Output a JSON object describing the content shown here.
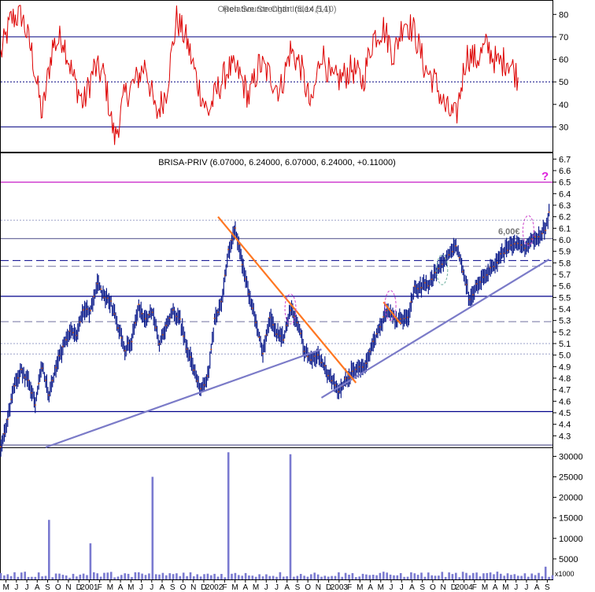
{
  "chart_data": [
    {
      "panel": "rsi",
      "type": "line",
      "title": "Relative Strength Index (14)",
      "title_overlay": "Open Source Chart (5,14,5,10)",
      "y_ticks": [
        "80",
        "70",
        "60",
        "50",
        "40",
        "30"
      ],
      "ylim": [
        20,
        85
      ],
      "reference_lines": [
        70,
        50,
        30
      ],
      "colors": {
        "line": "#dd0000",
        "ref": "#000080"
      },
      "series_key": [
        [
          0,
          62
        ],
        [
          3,
          78
        ],
        [
          6,
          80
        ],
        [
          9,
          63
        ],
        [
          12,
          35
        ],
        [
          15,
          66
        ],
        [
          18,
          70
        ],
        [
          21,
          52
        ],
        [
          24,
          40
        ],
        [
          27,
          56
        ],
        [
          30,
          53
        ],
        [
          33,
          24
        ],
        [
          36,
          44
        ],
        [
          39,
          50
        ],
        [
          42,
          58
        ],
        [
          45,
          35
        ],
        [
          48,
          46
        ],
        [
          51,
          78
        ],
        [
          54,
          68
        ],
        [
          57,
          50
        ],
        [
          60,
          36
        ],
        [
          63,
          47
        ],
        [
          66,
          56
        ],
        [
          69,
          54
        ],
        [
          72,
          43
        ],
        [
          75,
          58
        ],
        [
          78,
          53
        ],
        [
          81,
          46
        ],
        [
          84,
          64
        ],
        [
          87,
          57
        ],
        [
          90,
          38
        ],
        [
          93,
          64
        ],
        [
          96,
          50
        ],
        [
          99,
          52
        ],
        [
          102,
          56
        ],
        [
          105,
          50
        ],
        [
          108,
          70
        ],
        [
          111,
          74
        ],
        [
          114,
          62
        ],
        [
          117,
          78
        ],
        [
          120,
          72
        ],
        [
          123,
          56
        ],
        [
          126,
          50
        ],
        [
          129,
          38
        ],
        [
          132,
          34
        ],
        [
          135,
          62
        ],
        [
          138,
          60
        ],
        [
          141,
          66
        ],
        [
          144,
          58
        ],
        [
          147,
          60
        ],
        [
          150,
          52
        ]
      ]
    },
    {
      "panel": "price",
      "type": "line",
      "title": "BRISA-PRIV (6.07000, 6.24000, 6.07000, 6.24000, +0.11000)",
      "y_ticks": [
        "6.7",
        "6.6",
        "6.5",
        "6.4",
        "6.3",
        "6.2",
        "6.1",
        "6.0",
        "5.9",
        "5.8",
        "5.7",
        "5.6",
        "5.5",
        "5.4",
        "5.3",
        "5.2",
        "5.1",
        "5.0",
        "4.9",
        "4.8",
        "4.7",
        "4.6",
        "4.5",
        "4.4",
        "4.3"
      ],
      "ylim": [
        4.2,
        6.75
      ],
      "annotations": {
        "level_label": "6,00€",
        "question": "?"
      },
      "horizontal_levels": [
        {
          "y": 6.5,
          "color": "#cc33cc",
          "style": "solid"
        },
        {
          "y": 6.17,
          "color": "#9aa0c8",
          "style": "dotted"
        },
        {
          "y": 6.01,
          "color": "#7070a0",
          "style": "solid"
        },
        {
          "y": 5.82,
          "color": "#00008b",
          "style": "dashed"
        },
        {
          "y": 5.77,
          "color": "#7070a0",
          "style": "dashed"
        },
        {
          "y": 5.51,
          "color": "#00008b",
          "style": "solid"
        },
        {
          "y": 5.29,
          "color": "#7070a0",
          "style": "dashed"
        },
        {
          "y": 5.1,
          "color": "#9aa0c8",
          "style": "dotted"
        },
        {
          "y": 5.01,
          "color": "#9aa0c8",
          "style": "dotted"
        },
        {
          "y": 4.51,
          "color": "#00008b",
          "style": "solid"
        },
        {
          "y": 4.22,
          "color": "#7070a0",
          "style": "solid"
        }
      ],
      "trendlines": [
        {
          "color": "#7b7bc8",
          "from": [
            13,
            4.2
          ],
          "to": [
            93,
            5.05
          ]
        },
        {
          "color": "#7b7bc8",
          "from": [
            93,
            4.63
          ],
          "to": [
            159,
            5.83
          ]
        },
        {
          "color": "#ff7722",
          "from": [
            63,
            6.2
          ],
          "to": [
            103,
            4.76
          ]
        },
        {
          "color": "#ff7722",
          "from": [
            111,
            5.46
          ],
          "to": [
            116,
            5.27
          ]
        }
      ],
      "highlights": [
        [
          84,
          5.4
        ],
        [
          113,
          5.43
        ],
        [
          128,
          5.74
        ],
        [
          153,
          6.08
        ]
      ],
      "series_key": [
        [
          0,
          4.2
        ],
        [
          2,
          4.45
        ],
        [
          4,
          4.75
        ],
        [
          6,
          4.86
        ],
        [
          8,
          4.78
        ],
        [
          10,
          4.58
        ],
        [
          12,
          4.9
        ],
        [
          14,
          4.65
        ],
        [
          16,
          4.9
        ],
        [
          18,
          5.06
        ],
        [
          20,
          5.22
        ],
        [
          22,
          5.18
        ],
        [
          24,
          5.4
        ],
        [
          26,
          5.38
        ],
        [
          28,
          5.62
        ],
        [
          30,
          5.5
        ],
        [
          32,
          5.45
        ],
        [
          34,
          5.24
        ],
        [
          36,
          5.05
        ],
        [
          38,
          5.12
        ],
        [
          40,
          5.42
        ],
        [
          42,
          5.3
        ],
        [
          44,
          5.38
        ],
        [
          46,
          5.1
        ],
        [
          48,
          5.25
        ],
        [
          50,
          5.38
        ],
        [
          52,
          5.3
        ],
        [
          54,
          5.05
        ],
        [
          56,
          4.88
        ],
        [
          58,
          4.7
        ],
        [
          60,
          4.8
        ],
        [
          62,
          5.3
        ],
        [
          64,
          5.45
        ],
        [
          66,
          5.9
        ],
        [
          68,
          6.1
        ],
        [
          70,
          5.8
        ],
        [
          72,
          5.55
        ],
        [
          74,
          5.28
        ],
        [
          76,
          5.02
        ],
        [
          78,
          5.32
        ],
        [
          80,
          5.2
        ],
        [
          82,
          5.15
        ],
        [
          84,
          5.4
        ],
        [
          86,
          5.3
        ],
        [
          88,
          5.05
        ],
        [
          90,
          4.95
        ],
        [
          92,
          5.0
        ],
        [
          94,
          4.9
        ],
        [
          96,
          4.78
        ],
        [
          98,
          4.7
        ],
        [
          100,
          4.78
        ],
        [
          102,
          4.86
        ],
        [
          104,
          4.88
        ],
        [
          106,
          4.93
        ],
        [
          108,
          5.1
        ],
        [
          110,
          5.25
        ],
        [
          112,
          5.4
        ],
        [
          114,
          5.32
        ],
        [
          116,
          5.3
        ],
        [
          118,
          5.32
        ],
        [
          120,
          5.58
        ],
        [
          122,
          5.6
        ],
        [
          124,
          5.62
        ],
        [
          126,
          5.72
        ],
        [
          128,
          5.8
        ],
        [
          130,
          5.88
        ],
        [
          132,
          5.95
        ],
        [
          134,
          5.72
        ],
        [
          136,
          5.48
        ],
        [
          138,
          5.6
        ],
        [
          140,
          5.66
        ],
        [
          142,
          5.74
        ],
        [
          144,
          5.82
        ],
        [
          146,
          5.9
        ],
        [
          148,
          5.95
        ],
        [
          150,
          5.98
        ],
        [
          152,
          5.92
        ],
        [
          154,
          6.0
        ],
        [
          156,
          6.02
        ],
        [
          158,
          6.1
        ],
        [
          159,
          6.24
        ]
      ]
    },
    {
      "panel": "volume",
      "type": "bar",
      "units_label": "x1000",
      "y_ticks": [
        "30000",
        "25000",
        "20000",
        "15000",
        "10000",
        "5000"
      ],
      "ylim": [
        0,
        32000
      ],
      "base_level": 1000,
      "spikes": [
        [
          8,
          600
        ],
        [
          14,
          14500
        ],
        [
          20,
          400
        ],
        [
          26,
          8800
        ],
        [
          38,
          600
        ],
        [
          44,
          25000
        ],
        [
          54,
          800
        ],
        [
          58,
          700
        ],
        [
          66,
          31000
        ],
        [
          70,
          900
        ],
        [
          84,
          30500
        ],
        [
          88,
          900
        ],
        [
          94,
          900
        ],
        [
          106,
          1200
        ],
        [
          114,
          1000
        ],
        [
          120,
          1500
        ],
        [
          126,
          900
        ],
        [
          136,
          1000
        ],
        [
          146,
          900
        ],
        [
          152,
          1500
        ],
        [
          158,
          3100
        ]
      ]
    }
  ],
  "x_axis": {
    "labels": [
      "M",
      "J",
      "J",
      "A",
      "S",
      "O",
      "N",
      "D",
      "2001",
      "F",
      "M",
      "A",
      "M",
      "J",
      "J",
      "A",
      "S",
      "O",
      "N",
      "D",
      "2002",
      "F",
      "M",
      "A",
      "M",
      "J",
      "J",
      "A",
      "S",
      "O",
      "N",
      "D",
      "2003",
      "F",
      "M",
      "A",
      "M",
      "J",
      "J",
      "A",
      "S",
      "O",
      "N",
      "D",
      "2004",
      "F",
      "M",
      "A",
      "M",
      "J",
      "J",
      "A",
      "S"
    ],
    "period_range": [
      "2000-05",
      "2004-09"
    ]
  }
}
